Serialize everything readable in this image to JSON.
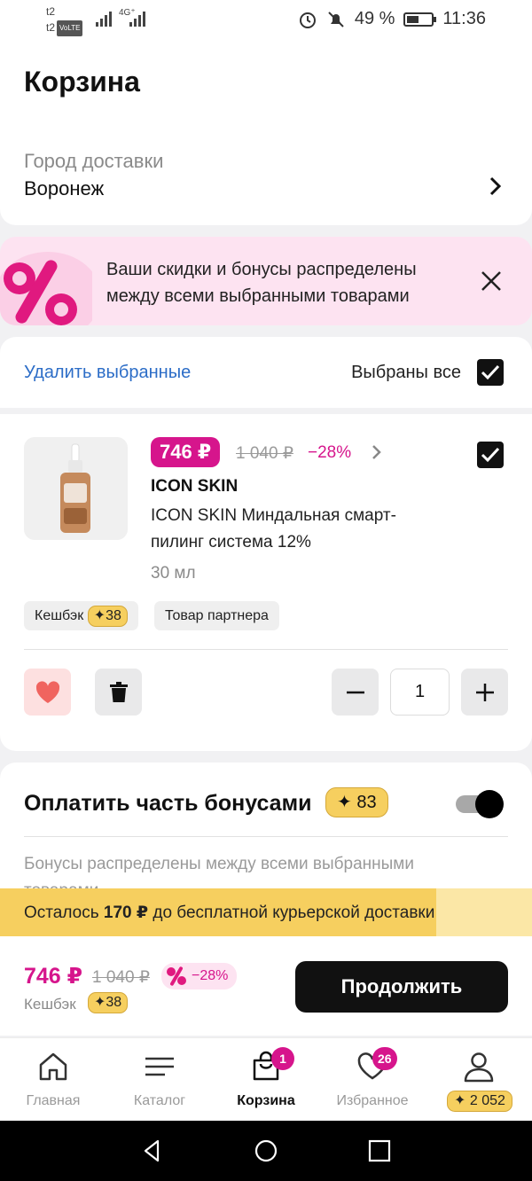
{
  "status_bar": {
    "carrier_1": "t2",
    "carrier_2": "t2",
    "volte": "VoLTE",
    "network": "4G⁺",
    "battery": "49 %",
    "time": "11:36"
  },
  "header": {
    "title": "Корзина",
    "city_label": "Город доставки",
    "city_value": "Воронеж"
  },
  "banner": {
    "text": "Ваши скидки и бонусы распределены между всеми выбранными товарами"
  },
  "selection": {
    "delete_selected": "Удалить выбранные",
    "all_selected": "Выбраны все",
    "all_checked": true
  },
  "item": {
    "price": "746 ₽",
    "old_price": "1 040 ₽",
    "discount": "−28%",
    "brand": "ICON SKIN",
    "name": "ICON SKIN Миндальная смарт-пилинг система 12%",
    "volume": "30 мл",
    "checked": true,
    "cashback_label": "Кешбэк",
    "cashback_value": "✦38",
    "partner_tag": "Товар партнера",
    "quantity": "1",
    "minus": "−",
    "plus": "+"
  },
  "bonus": {
    "title": "Оплатить часть бонусами",
    "amount": "✦ 83",
    "enabled": true,
    "description": "Бонусы распределены между всеми выбранными товарами"
  },
  "delivery": {
    "prefix": "Осталось ",
    "amount": "170 ₽",
    "suffix": " до бесплатной курьерской доставки",
    "progress": 0.82
  },
  "checkout": {
    "total": "746 ₽",
    "old_total": "1 040 ₽",
    "discount": "−28%",
    "cashback_label": "Кешбэк",
    "cashback_value": "✦38",
    "button": "Продолжить"
  },
  "tabs": [
    {
      "label": "Главная",
      "icon": "home-icon"
    },
    {
      "label": "Каталог",
      "icon": "menu-icon"
    },
    {
      "label": "Корзина",
      "icon": "cart-icon",
      "badge": "1",
      "active": true
    },
    {
      "label": "Избранное",
      "icon": "heart-icon",
      "badge": "26"
    },
    {
      "label": "",
      "icon": "profile-icon",
      "badge": "✦ 2 052"
    }
  ],
  "colors": {
    "accent": "#d6158c",
    "link": "#2c6dc7",
    "bonus_gold": "#f6cf5f",
    "banner_bg": "#fde3f1"
  }
}
